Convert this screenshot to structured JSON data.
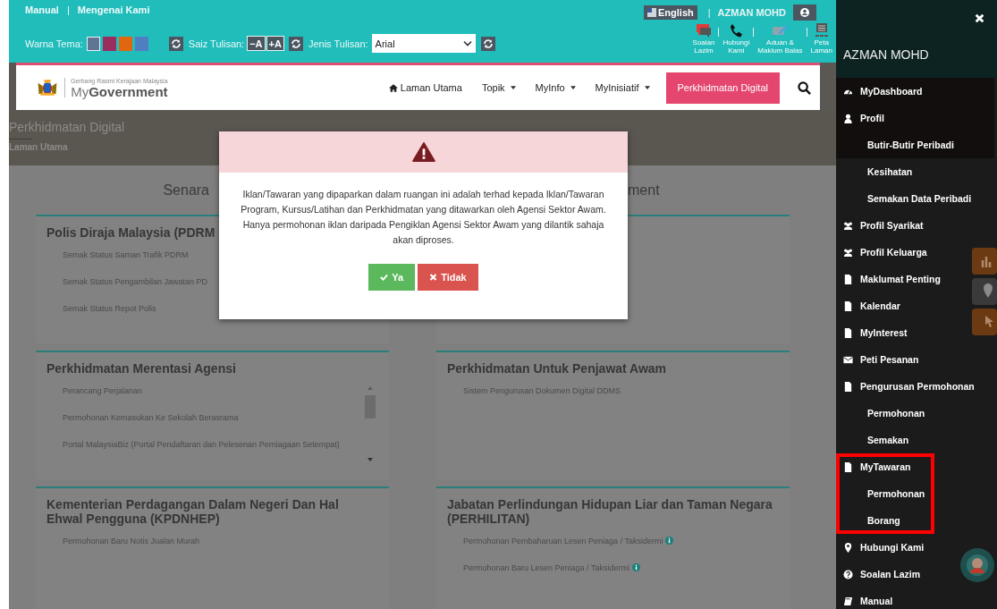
{
  "top_links": [
    "Manual",
    "|",
    "Mengenai Kami"
  ],
  "theme": {
    "label": "Warna Tema:",
    "swatches": [
      {
        "color": "#5f7591",
        "selected": true
      },
      {
        "color": "#9b2d5e",
        "selected": false
      },
      {
        "color": "#e0670f",
        "selected": false
      },
      {
        "color": "#4f7fc2",
        "selected": false
      }
    ]
  },
  "font_size": {
    "label": "Saiz Tulisan:",
    "buttons": [
      "−A",
      "+A"
    ]
  },
  "font_type": {
    "label": "Jenis Tulisan:",
    "value": "Arial"
  },
  "account": {
    "language": "English",
    "separator": "|",
    "user": "AZMAN MOHD"
  },
  "quick_links": [
    {
      "kind": "faq",
      "label": "Soalan\nLazim"
    },
    {
      "kind": "phone",
      "label": "Hubungi\nKami"
    },
    {
      "kind": "feedback",
      "label": "Aduan &\nMaklum Balas"
    },
    {
      "kind": "sitemap",
      "label": "Peta\nLaman"
    }
  ],
  "logo": {
    "tagline": "Gerbang Rasmi Kerajaan Malaysia",
    "name_light": "My",
    "name_bold": "Government"
  },
  "nav": [
    {
      "kind": "home",
      "label": "Laman Utama"
    },
    {
      "kind": "dropdown",
      "label": "Topik"
    },
    {
      "kind": "dropdown",
      "label": "MyInfo"
    },
    {
      "kind": "dropdown",
      "label": "MyInisiatif"
    },
    {
      "kind": "button",
      "label": "Perkhidmatan Digital"
    }
  ],
  "banner": {
    "title": "Perkhidmatan Digital",
    "breadcrumb": "Laman Utama"
  },
  "heading_parts": [
    "Senara",
    "ment"
  ],
  "columns": [
    [
      {
        "title": "Polis Diraja Malaysia (PDRM",
        "scroll": false,
        "items": [
          {
            "label": "Semak Status Saman Trafik PDRM",
            "info": false
          },
          {
            "label": "Semak Status Pengambilan Jawatan PD",
            "info": false
          },
          {
            "label": "Semak Status Repot Polis",
            "info": false
          }
        ]
      },
      {
        "title": "Perkhidmatan Merentasi Agensi",
        "scroll": true,
        "items": [
          {
            "label": "Perancang Perjalanan",
            "info": false
          },
          {
            "label": "Permohonan Kemasukan Ke Sekolah Berasrama",
            "info": false
          },
          {
            "label": "Portal MalaysiaBiz (Portal Pendaftaran dan Pelesenan Perniagaan Setempat)",
            "info": false
          }
        ]
      },
      {
        "title": "Kementerian Perdagangan Dalam Negeri Dan Hal Ehwal Pengguna (KPDNHEP)",
        "scroll": false,
        "items": [
          {
            "label": "Permohonan Baru Notis Jualan Murah",
            "info": false
          }
        ]
      }
    ],
    [
      {
        "scroll": false
      },
      {
        "title": "Perkhidmatan Untuk Penjawat Awam",
        "scroll": false,
        "items": [
          {
            "label": "Sistem Pengurusan Dokumen Digital DDMS",
            "info": false
          }
        ]
      },
      {
        "title": "Jabatan Perlindungan Hidupan Liar dan Taman Negara (PERHILITAN)",
        "scroll": false,
        "items": [
          {
            "label": "Permohonan Pembaharuan Lesen Peniaga / Taksidermi",
            "info": true
          },
          {
            "label": "Permohonan Baru Lesen Peniaga / Taksidermi",
            "info": true
          }
        ]
      }
    ]
  ],
  "modal": {
    "message": "Iklan/Tawaran yang dipaparkan dalam ruangan ini adalah terhad kepada Iklan/Tawaran Program, Kursus/Latihan dan Perkhidmatan yang ditawarkan oleh Agensi Sektor Awam. Hanya permohonan iklan daripada Pengiklan Agensi Sektor Awam yang dilantik sahaja akan diproses.",
    "buttons": [
      {
        "kind": "confirm",
        "label": "Ya"
      },
      {
        "kind": "cancel",
        "label": "Tidak"
      }
    ]
  },
  "sidebar": {
    "title": "AZMAN MOHD",
    "groups": [
      {
        "marked": false,
        "items": [
          {
            "kind": "dashboard",
            "label": "MyDashboard",
            "highlighted": true
          }
        ]
      },
      {
        "marked": false,
        "items": [
          {
            "kind": "user",
            "label": "Profil",
            "highlighted": true,
            "children": [
              {
                "label": "Butir-Butir Peribadi",
                "highlighted": true
              },
              {
                "label": "Kesihatan",
                "highlighted": false
              },
              {
                "label": "Semakan Data Peribadi",
                "highlighted": false
              }
            ]
          }
        ]
      },
      {
        "marked": false,
        "items": [
          {
            "kind": "users",
            "label": "Profil Syarikat",
            "highlighted": false
          },
          {
            "kind": "users",
            "label": "Profil Keluarga",
            "highlighted": false
          },
          {
            "kind": "file",
            "label": "Maklumat Penting",
            "highlighted": false
          },
          {
            "kind": "file",
            "label": "Kalendar",
            "highlighted": false
          },
          {
            "kind": "file",
            "label": "MyInterest",
            "highlighted": false
          },
          {
            "kind": "envelope",
            "label": "Peti Pesanan",
            "highlighted": false
          },
          {
            "kind": "file",
            "label": "Pengurusan Permohonan",
            "highlighted": false,
            "children": [
              {
                "label": "Permohonan",
                "highlighted": false
              },
              {
                "label": "Semakan",
                "highlighted": false
              }
            ]
          }
        ]
      },
      {
        "marked": true,
        "items": [
          {
            "kind": "file",
            "label": "MyTawaran",
            "highlighted": false,
            "children": [
              {
                "label": "Permohonan",
                "highlighted": false
              },
              {
                "label": "Borang",
                "highlighted": false
              }
            ]
          }
        ]
      },
      {
        "marked": false,
        "items": [
          {
            "kind": "pin",
            "label": "Hubungi Kami",
            "highlighted": false
          },
          {
            "kind": "question",
            "label": "Soalan Lazim",
            "highlighted": false
          },
          {
            "kind": "book",
            "label": "Manual",
            "highlighted": false
          }
        ]
      }
    ]
  }
}
